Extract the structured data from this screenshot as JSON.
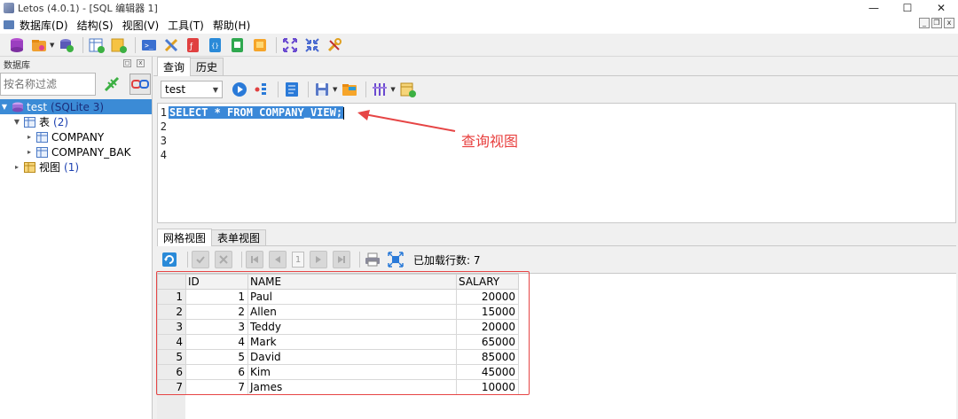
{
  "titlebar": {
    "title": "Letos (4.0.1) - [SQL 编辑器 1]",
    "minimize": "—",
    "maximize": "☐",
    "close": "✕"
  },
  "menubar": {
    "items": [
      "数据库(D)",
      "结构(S)",
      "视图(V)",
      "工具(T)",
      "帮助(H)"
    ]
  },
  "left_panel": {
    "header": "数据库",
    "filter_placeholder": "按名称过滤",
    "tree": {
      "db": {
        "name": "test",
        "type": "(SQLite 3)"
      },
      "tables": {
        "label": "表",
        "count": "(2)",
        "items": [
          "COMPANY",
          "COMPANY_BAK"
        ]
      },
      "views": {
        "label": "视图",
        "count": "(1)"
      }
    }
  },
  "editor_tabs": [
    "查询",
    "历史"
  ],
  "query_toolbar": {
    "db_select": "test"
  },
  "editor": {
    "line_numbers": [
      "1",
      "2",
      "3",
      "4"
    ],
    "code": "SELECT * FROM COMPANY_VIEW;"
  },
  "annotation": {
    "label": "查询视图",
    "color": "#e8403f"
  },
  "result_tabs": [
    "网格视图",
    "表单视图"
  ],
  "result_toolbar": {
    "page": "1",
    "rows_loaded": "已加载行数: 7"
  },
  "grid": {
    "columns": [
      "ID",
      "NAME",
      "SALARY"
    ],
    "rows": [
      {
        "rn": "1",
        "id": "1",
        "name": "Paul",
        "salary": "20000"
      },
      {
        "rn": "2",
        "id": "2",
        "name": "Allen",
        "salary": "15000"
      },
      {
        "rn": "3",
        "id": "3",
        "name": "Teddy",
        "salary": "20000"
      },
      {
        "rn": "4",
        "id": "4",
        "name": "Mark",
        "salary": "65000"
      },
      {
        "rn": "5",
        "id": "5",
        "name": "David",
        "salary": "85000"
      },
      {
        "rn": "6",
        "id": "6",
        "name": "Kim",
        "salary": "45000"
      },
      {
        "rn": "7",
        "id": "7",
        "name": "James",
        "salary": "10000"
      }
    ]
  },
  "colors": {
    "selection": "#3b8bd6",
    "annotation_red": "#e64545"
  }
}
